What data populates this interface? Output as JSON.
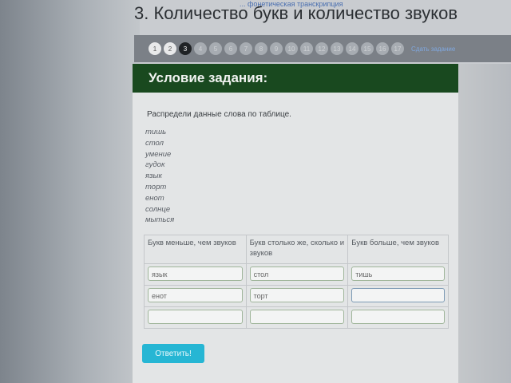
{
  "breadcrumb": "... фонетическая транскрипция",
  "page_title": "3. Количество букв и количество звуков",
  "steps": [
    "1",
    "2",
    "3",
    "4",
    "5",
    "6",
    "7",
    "8",
    "9",
    "10",
    "11",
    "12",
    "13",
    "14",
    "15",
    "16",
    "17"
  ],
  "current_step": "3",
  "steps_link": "Сдать задание",
  "header": {
    "title": "Условие задания:"
  },
  "instruction": "Распредели данные слова по таблице.",
  "words": [
    "тишь",
    "стол",
    "умение",
    "гудок",
    "язык",
    "торт",
    "енот",
    "солнце",
    "мыться"
  ],
  "table": {
    "headers": [
      "Букв меньше, чем звуков",
      "Букв столько же, сколько и звуков",
      "Букв больше, чем звуков"
    ],
    "rows": [
      [
        "язык",
        "стол",
        "тишь"
      ],
      [
        "енот",
        "торт",
        ""
      ],
      [
        "",
        "",
        ""
      ]
    ]
  },
  "answer_button": "Ответить!"
}
